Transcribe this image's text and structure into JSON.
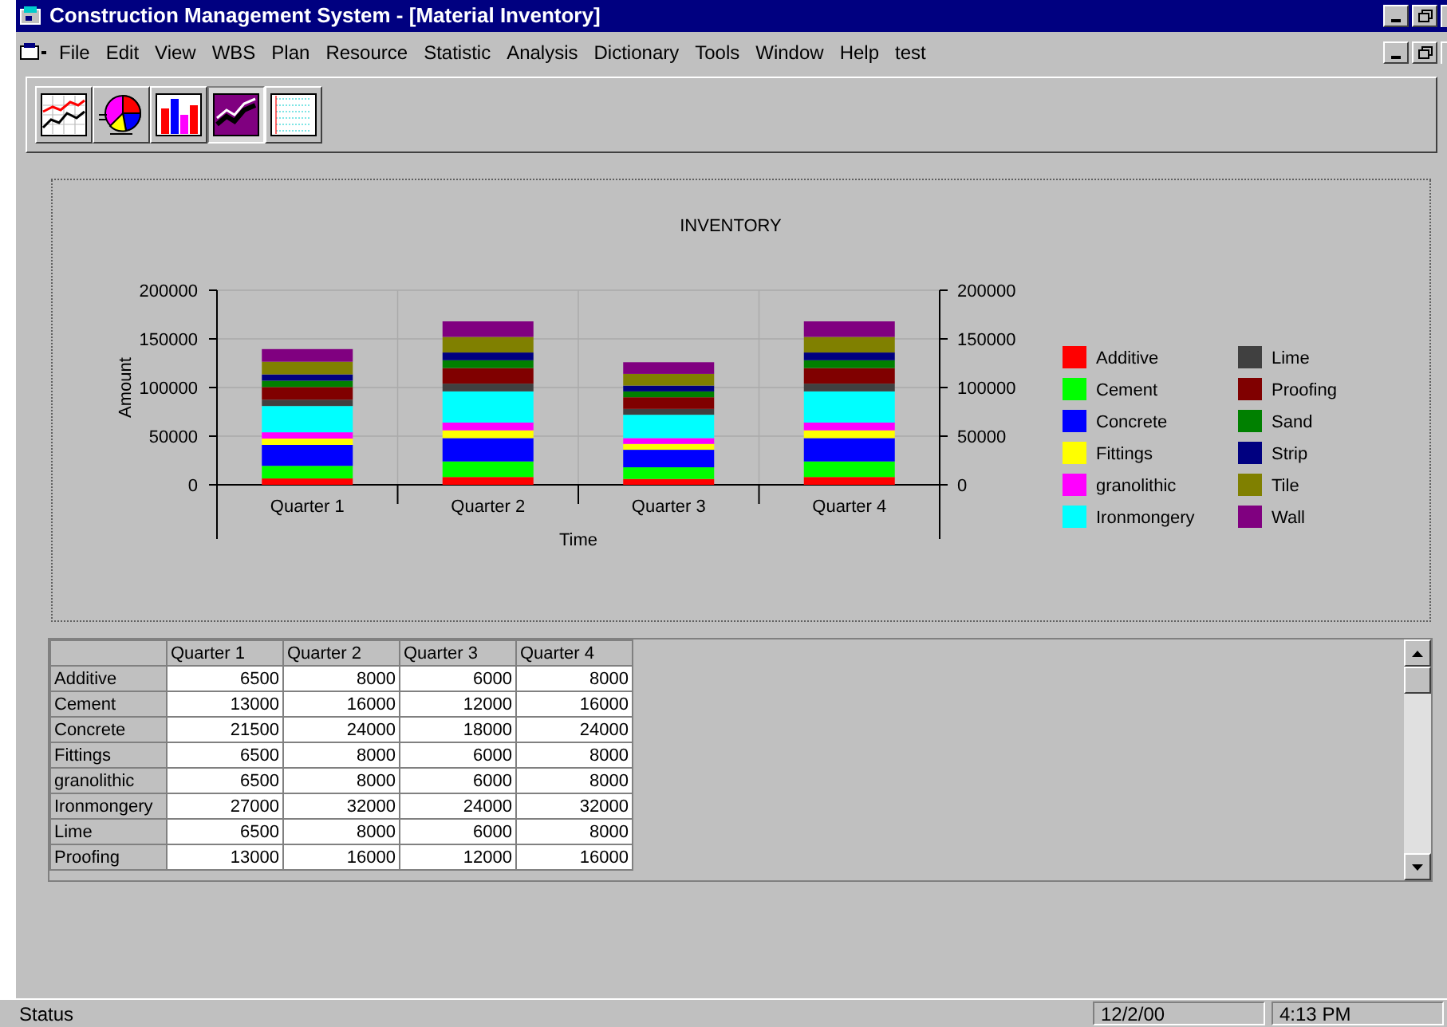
{
  "window": {
    "title": "Construction Management System - [Material Inventory]"
  },
  "menu": [
    "File",
    "Edit",
    "View",
    "WBS",
    "Plan",
    "Resource",
    "Statistic",
    "Analysis",
    "Dictionary",
    "Tools",
    "Window",
    "Help",
    "test"
  ],
  "toolbar": [
    {
      "kind": "line",
      "selected": false
    },
    {
      "kind": "pie",
      "selected": false
    },
    {
      "kind": "bar",
      "selected": false
    },
    {
      "kind": "stacked",
      "selected": true
    },
    {
      "kind": "grid",
      "selected": false
    }
  ],
  "chart": {
    "left_axis": {
      "labels": [
        "200000",
        "150000",
        "100000",
        "50000",
        "0"
      ]
    },
    "right_axis": {
      "labels": [
        "200000",
        "150000",
        "100000",
        "50000",
        "0"
      ]
    },
    "chart_data": {
      "type": "bar",
      "stacked": true,
      "grid": true,
      "legend": true,
      "title": "INVENTORY",
      "xlabel": "Time",
      "ylabel": "Amount",
      "categories": [
        "Quarter 1",
        "Quarter 2",
        "Quarter 3",
        "Quarter 4"
      ],
      "ylim": [
        0,
        200000
      ],
      "yticks": [
        0,
        50000,
        100000,
        150000,
        200000
      ],
      "series": [
        {
          "name": "Additive",
          "color": "#ff0000",
          "values": [
            6500,
            8000,
            6000,
            8000
          ]
        },
        {
          "name": "Cement",
          "color": "#00ff00",
          "values": [
            13000,
            16000,
            12000,
            16000
          ]
        },
        {
          "name": "Concrete",
          "color": "#0000ff",
          "values": [
            21500,
            24000,
            18000,
            24000
          ]
        },
        {
          "name": "Fittings",
          "color": "#ffff00",
          "values": [
            6500,
            8000,
            6000,
            8000
          ]
        },
        {
          "name": "granolithic",
          "color": "#ff00ff",
          "values": [
            6500,
            8000,
            6000,
            8000
          ]
        },
        {
          "name": "Ironmongery",
          "color": "#00ffff",
          "values": [
            27000,
            32000,
            24000,
            32000
          ]
        },
        {
          "name": "Lime",
          "color": "#404040",
          "values": [
            6500,
            8000,
            6000,
            8000
          ]
        },
        {
          "name": "Proofing",
          "color": "#800000",
          "values": [
            13000,
            16000,
            12000,
            16000
          ]
        },
        {
          "name": "Sand",
          "color": "#008000",
          "values": [
            6500,
            8000,
            6000,
            8000
          ]
        },
        {
          "name": "Strip",
          "color": "#000080",
          "values": [
            6500,
            8000,
            6000,
            8000
          ]
        },
        {
          "name": "Tile",
          "color": "#808000",
          "values": [
            13000,
            16000,
            12000,
            16000
          ]
        },
        {
          "name": "Wall",
          "color": "#800080",
          "values": [
            13000,
            16000,
            12000,
            16000
          ]
        }
      ]
    }
  },
  "table": {
    "columns": [
      "Quarter 1",
      "Quarter 2",
      "Quarter 3",
      "Quarter 4"
    ],
    "rows": [
      {
        "label": "Additive",
        "cells": [
          "6500",
          "8000",
          "6000",
          "8000"
        ]
      },
      {
        "label": "Cement",
        "cells": [
          "13000",
          "16000",
          "12000",
          "16000"
        ]
      },
      {
        "label": "Concrete",
        "cells": [
          "21500",
          "24000",
          "18000",
          "24000"
        ]
      },
      {
        "label": "Fittings",
        "cells": [
          "6500",
          "8000",
          "6000",
          "8000"
        ]
      },
      {
        "label": "granolithic",
        "cells": [
          "6500",
          "8000",
          "6000",
          "8000"
        ]
      },
      {
        "label": "Ironmongery",
        "cells": [
          "27000",
          "32000",
          "24000",
          "32000"
        ]
      },
      {
        "label": "Lime",
        "cells": [
          "6500",
          "8000",
          "6000",
          "8000"
        ]
      },
      {
        "label": "Proofing",
        "cells": [
          "13000",
          "16000",
          "12000",
          "16000"
        ]
      }
    ]
  },
  "status_bar": {
    "text": "Status",
    "date": "12/2/00",
    "time": "4:13 PM"
  }
}
